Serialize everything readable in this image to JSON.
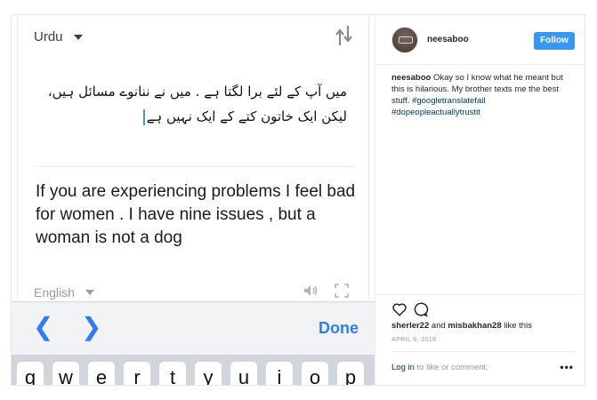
{
  "translator": {
    "source_language": "Urdu",
    "source_text": "میں آپ کے لئے برا لگتا ہے . میں نے ننانوے مسائل ہیں، لیکن ایک خاتون کتے کے ایک نہیں ہے",
    "translated_text": "If you are experiencing problems I feel bad for women . I have nine issues , but a woman is not a dog",
    "target_language": "English",
    "done_label": "Done",
    "prev_glyph": "❮",
    "next_glyph": "❯",
    "keys": [
      "q",
      "w",
      "e",
      "r",
      "t",
      "y",
      "u",
      "i",
      "o",
      "p"
    ],
    "icons": {
      "swap": "swap-arrows-icon",
      "speaker": "speaker-icon",
      "expand": "expand-icon"
    }
  },
  "post": {
    "username": "neesaboo",
    "follow_label": "Follow",
    "caption_user": "neesaboo",
    "caption_text": " Okay so I know what he meant but this is hilarious. My brother texts me the best stuff. ",
    "hashtag_1": "#googletranslatefail",
    "hashtag_2": "#dopeopleactuallytrustit",
    "likes_user_1": "sherler22",
    "likes_and": " and ",
    "likes_user_2": "misbakhan28",
    "likes_suffix": " like this",
    "date": "APRIL 6, 2016",
    "login_link": "Log in",
    "login_text": " to like or comment.",
    "more_glyph": "•••",
    "colors": {
      "follow_bg": "#3897f0",
      "hashtag": "#003569",
      "ios_blue": "#2f7cf6"
    }
  }
}
